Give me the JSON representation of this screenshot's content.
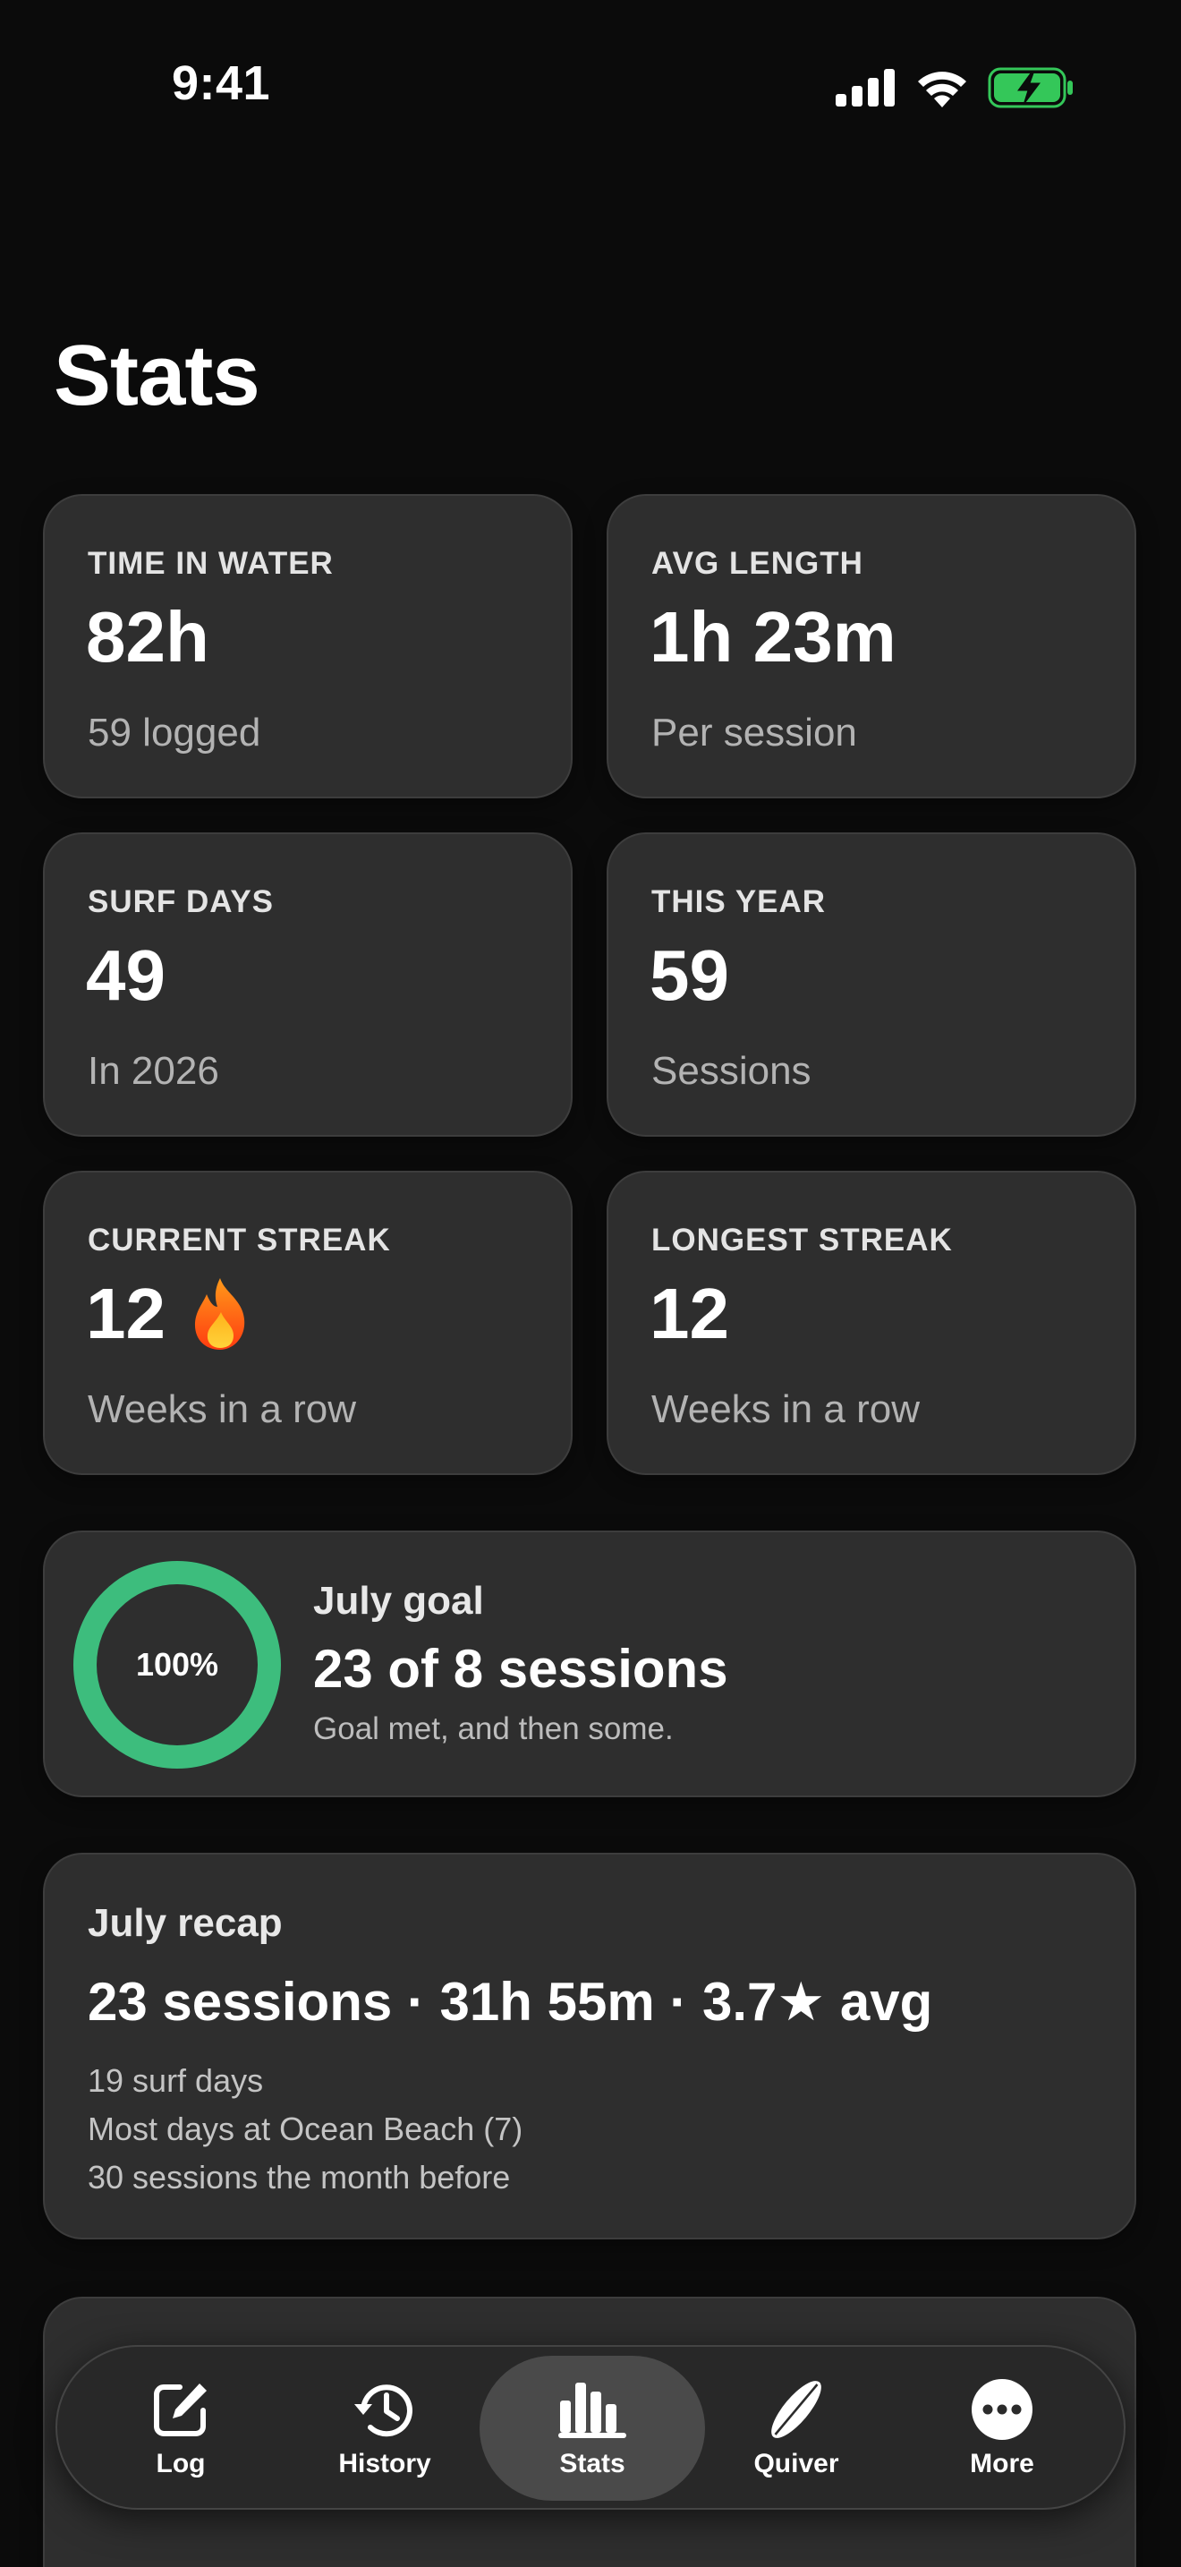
{
  "status_bar": {
    "time": "9:41"
  },
  "page": {
    "title": "Stats"
  },
  "stats": [
    {
      "label": "TIME IN WATER",
      "value": "82h",
      "sub": "59 logged"
    },
    {
      "label": "AVG LENGTH",
      "value": "1h 23m",
      "sub": "Per session"
    },
    {
      "label": "SURF DAYS",
      "value": "49",
      "sub": "In 2026"
    },
    {
      "label": "THIS YEAR",
      "value": "59",
      "sub": "Sessions"
    },
    {
      "label": "CURRENT STREAK",
      "value": "12",
      "emoji": "🔥",
      "sub": "Weeks in a row"
    },
    {
      "label": "LONGEST STREAK",
      "value": "12",
      "sub": "Weeks in a row"
    }
  ],
  "goal": {
    "percent_text": "100%",
    "progress": 1.0,
    "title": "July goal",
    "value": "23 of 8 sessions",
    "sub": "Goal met, and then some.",
    "ring_color": "#3dbd7d"
  },
  "recap": {
    "title": "July recap",
    "headline": "23 sessions · 31h 55m · 3.7★ avg",
    "lines": [
      "19 surf days",
      "Most days at Ocean Beach (7)",
      "30 sessions the month before"
    ]
  },
  "tabs": [
    {
      "label": "Log",
      "icon": "compose-icon"
    },
    {
      "label": "History",
      "icon": "history-clock-icon"
    },
    {
      "label": "Stats",
      "icon": "bar-chart-icon",
      "active": true
    },
    {
      "label": "Quiver",
      "icon": "surfboard-icon"
    },
    {
      "label": "More",
      "icon": "ellipsis-circle-icon"
    }
  ],
  "colors": {
    "background": "#0b0b0b",
    "card": "#2e2e2e",
    "accent_green": "#3dbd7d",
    "battery_green": "#34c759"
  }
}
